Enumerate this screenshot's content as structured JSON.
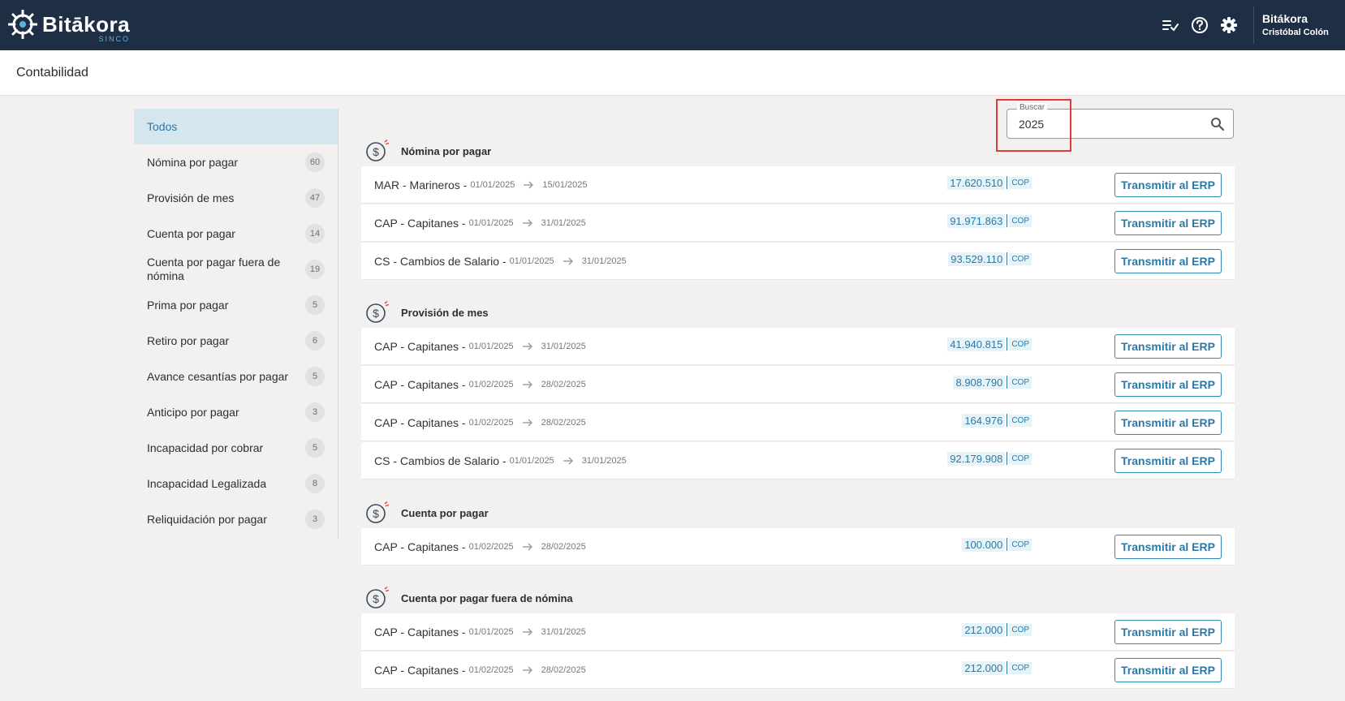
{
  "brand": {
    "name": "Bitākora",
    "sub": "SINCO",
    "colors": {
      "primary": "#1e2f45",
      "accent": "#2d79a6"
    }
  },
  "topbar": {
    "icons": [
      "checklist-icon",
      "help-icon",
      "gear-icon"
    ],
    "user": {
      "title": "Bitákora",
      "name": "Cristóbal Colón"
    }
  },
  "page": {
    "title": "Contabilidad"
  },
  "search": {
    "label": "Buscar",
    "value": "2025"
  },
  "sidebar": {
    "items": [
      {
        "label": "Todos",
        "count": ""
      },
      {
        "label": "Nómina por pagar",
        "count": "60"
      },
      {
        "label": "Provisión de mes",
        "count": "47"
      },
      {
        "label": "Cuenta por pagar",
        "count": "14"
      },
      {
        "label": "Cuenta por pagar fuera de nómina",
        "count": "19"
      },
      {
        "label": "Prima por pagar",
        "count": "5"
      },
      {
        "label": "Retiro por pagar",
        "count": "6"
      },
      {
        "label": "Avance cesantías por pagar",
        "count": "5"
      },
      {
        "label": "Anticipo por pagar",
        "count": "3"
      },
      {
        "label": "Incapacidad por cobrar",
        "count": "5"
      },
      {
        "label": "Incapacidad Legalizada",
        "count": "8"
      },
      {
        "label": "Reliquidación por pagar",
        "count": "3"
      }
    ]
  },
  "sections": [
    {
      "title": "Nómina por pagar",
      "rows": [
        {
          "name": "MAR - Marineros -",
          "from": "01/01/2025",
          "to": "15/01/2025",
          "amount": "17.620.510",
          "currency": "COP",
          "button": "Transmitir al ERP"
        },
        {
          "name": "CAP - Capitanes -",
          "from": "01/01/2025",
          "to": "31/01/2025",
          "amount": "91.971.863",
          "currency": "COP",
          "button": "Transmitir al ERP"
        },
        {
          "name": "CS - Cambios de Salario -",
          "from": "01/01/2025",
          "to": "31/01/2025",
          "amount": "93.529.110",
          "currency": "COP",
          "button": "Transmitir al ERP"
        }
      ]
    },
    {
      "title": "Provisión de mes",
      "rows": [
        {
          "name": "CAP - Capitanes -",
          "from": "01/01/2025",
          "to": "31/01/2025",
          "amount": "41.940.815",
          "currency": "COP",
          "button": "Transmitir al ERP"
        },
        {
          "name": "CAP - Capitanes -",
          "from": "01/02/2025",
          "to": "28/02/2025",
          "amount": "8.908.790",
          "currency": "COP",
          "button": "Transmitir al ERP"
        },
        {
          "name": "CAP - Capitanes -",
          "from": "01/02/2025",
          "to": "28/02/2025",
          "amount": "164.976",
          "currency": "COP",
          "button": "Transmitir al ERP"
        },
        {
          "name": "CS - Cambios de Salario -",
          "from": "01/01/2025",
          "to": "31/01/2025",
          "amount": "92.179.908",
          "currency": "COP",
          "button": "Transmitir al ERP"
        }
      ]
    },
    {
      "title": "Cuenta por pagar",
      "rows": [
        {
          "name": "CAP - Capitanes -",
          "from": "01/02/2025",
          "to": "28/02/2025",
          "amount": "100.000",
          "currency": "COP",
          "button": "Transmitir al ERP"
        }
      ]
    },
    {
      "title": "Cuenta por pagar fuera de nómina",
      "rows": [
        {
          "name": "CAP - Capitanes -",
          "from": "01/01/2025",
          "to": "31/01/2025",
          "amount": "212.000",
          "currency": "COP",
          "button": "Transmitir al ERP"
        },
        {
          "name": "CAP - Capitanes -",
          "from": "01/02/2025",
          "to": "28/02/2025",
          "amount": "212.000",
          "currency": "COP",
          "button": "Transmitir al ERP"
        }
      ]
    }
  ]
}
